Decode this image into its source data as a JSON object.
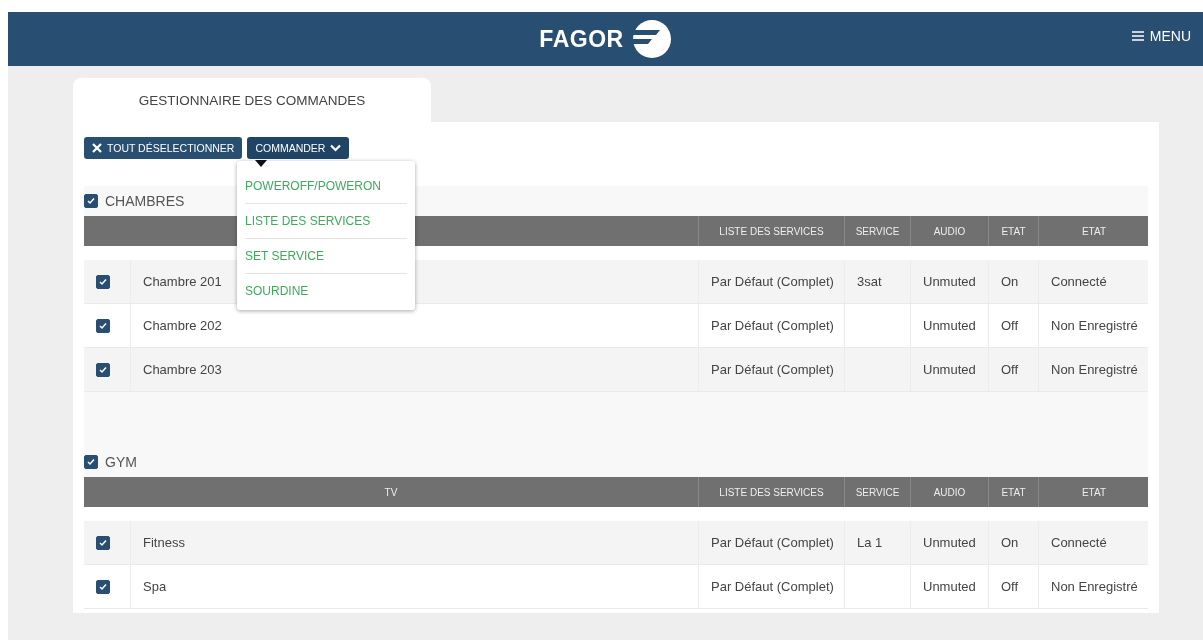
{
  "header": {
    "logo_text": "FAGOR",
    "menu_label": "MENU"
  },
  "tabs": [
    {
      "label": "GESTIONNAIRE DES COMMANDES",
      "selected": true
    }
  ],
  "toolbar": {
    "deselect_label": "TOUT DÉSELECTIONNER",
    "command_label": "COMMANDER"
  },
  "dropdown": {
    "open": true,
    "items": [
      "POWEROFF/POWERON",
      "LISTE DES SERVICES",
      "SET SERVICE",
      "SOURDINE"
    ]
  },
  "groups": [
    {
      "name": "CHAMBRES",
      "checked": true,
      "columns": [
        "",
        "LISTE DES SERVICES",
        "SERVICE",
        "AUDIO",
        "ETAT",
        "ETAT"
      ],
      "rows": [
        {
          "checked": true,
          "cells": [
            "Chambre 201",
            "Par Défaut (Complet)",
            "3sat",
            "Unmuted",
            "On",
            "Connecté"
          ]
        },
        {
          "checked": true,
          "cells": [
            "Chambre 202",
            "Par Défaut (Complet)",
            "",
            "Unmuted",
            "Off",
            "Non Enregistré"
          ]
        },
        {
          "checked": true,
          "cells": [
            "Chambre 203",
            "Par Défaut (Complet)",
            "",
            "Unmuted",
            "Off",
            "Non Enregistré"
          ]
        }
      ]
    },
    {
      "name": "GYM",
      "checked": true,
      "columns": [
        "TV",
        "LISTE DES SERVICES",
        "SERVICE",
        "AUDIO",
        "ETAT",
        "ETAT"
      ],
      "rows": [
        {
          "checked": true,
          "cells": [
            "Fitness",
            "Par Défaut (Complet)",
            "La 1",
            "Unmuted",
            "On",
            "Connecté"
          ]
        },
        {
          "checked": true,
          "cells": [
            "Spa",
            "Par Défaut (Complet)",
            "",
            "Unmuted",
            "Off",
            "Non Enregistré"
          ]
        }
      ]
    }
  ]
}
